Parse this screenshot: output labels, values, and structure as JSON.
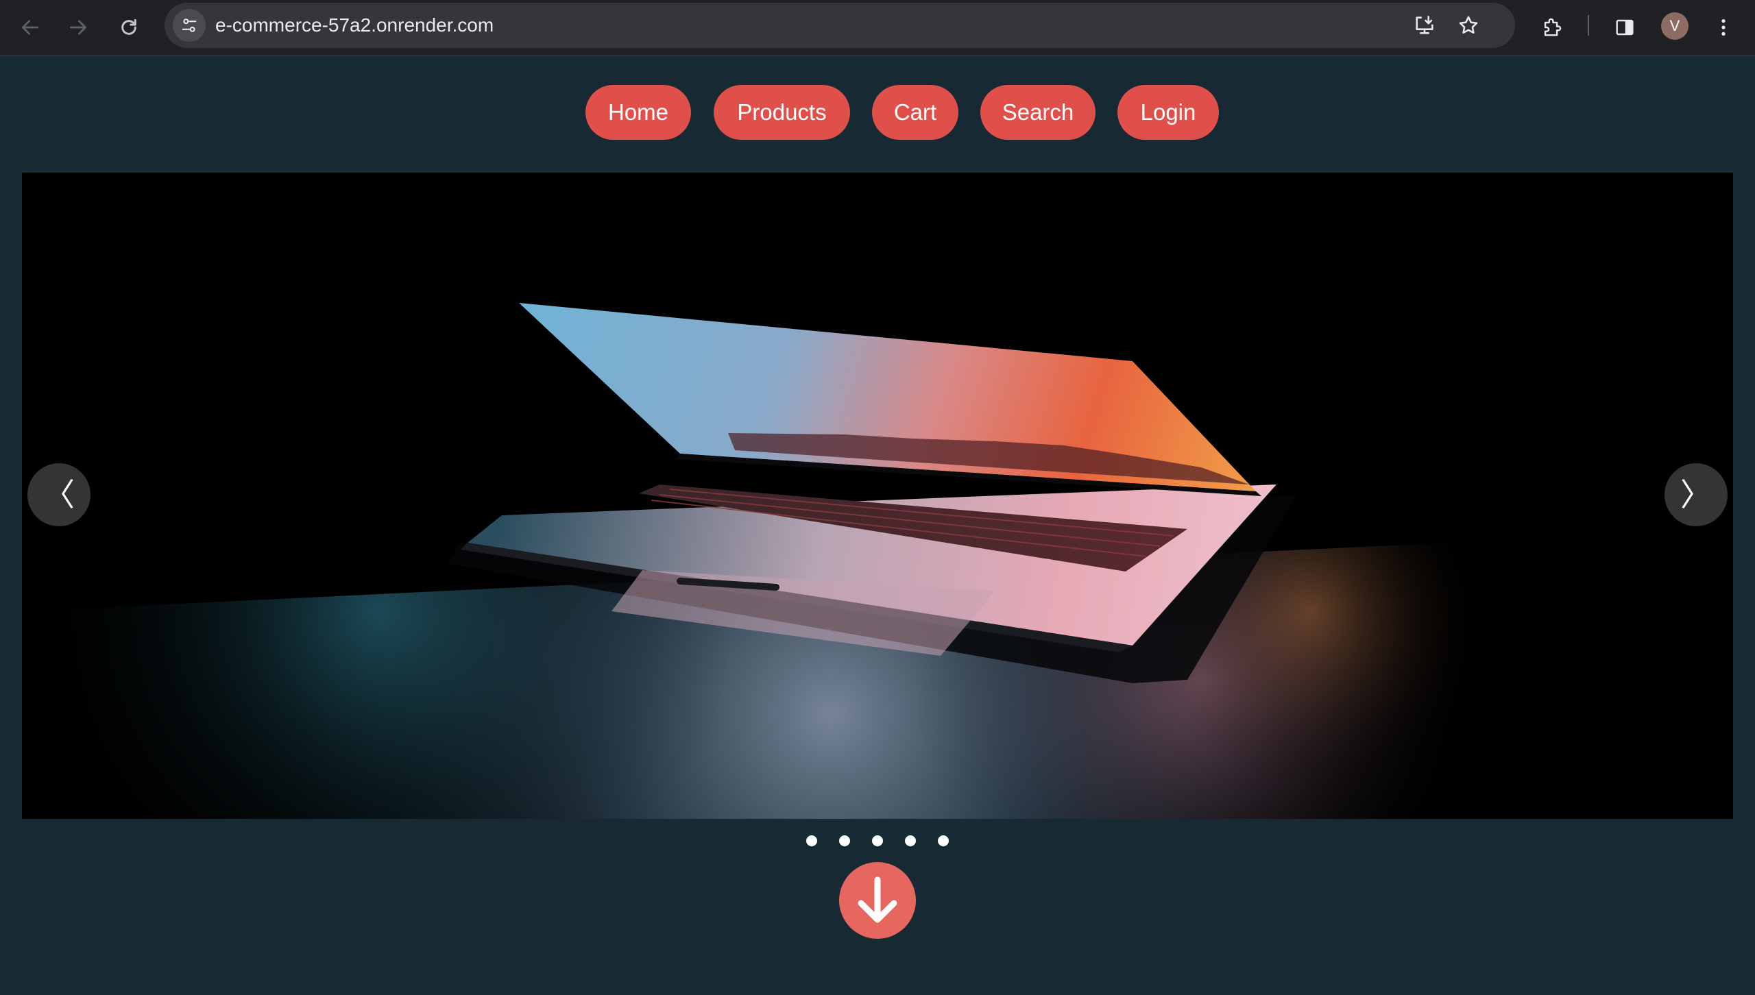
{
  "browser": {
    "url": "e-commerce-57a2.onrender.com",
    "back_icon": "arrow-left-icon",
    "forward_icon": "arrow-right-icon",
    "reload_icon": "reload-icon",
    "site_info_icon": "tune-icon",
    "install_icon": "install-app-icon",
    "bookmark_icon": "star-icon",
    "extensions_icon": "puzzle-icon",
    "sidepanel_icon": "side-panel-icon",
    "profile_initial": "V",
    "menu_icon": "kebab-menu-icon"
  },
  "nav": {
    "items": [
      {
        "label": "Home"
      },
      {
        "label": "Products"
      },
      {
        "label": "Cart"
      },
      {
        "label": "Search"
      },
      {
        "label": "Login"
      }
    ]
  },
  "carousel": {
    "prev_glyph": "〈",
    "next_glyph": "〉",
    "slide_count": 5,
    "image_subject": "laptop-image"
  },
  "colors": {
    "page_bg": "#172a33",
    "accent": "#e0504a",
    "scroll_button": "#e56760"
  }
}
